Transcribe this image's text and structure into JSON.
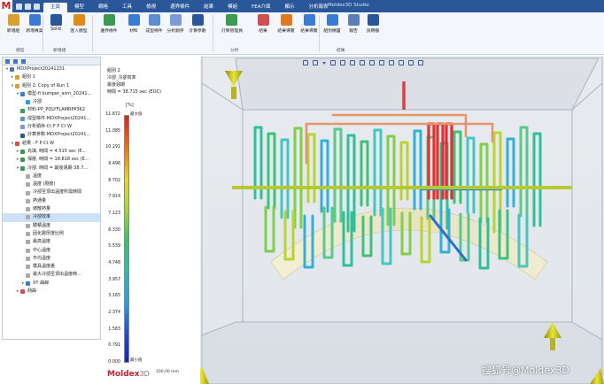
{
  "titlebar": {
    "logo": "M",
    "window_title": "Moldex3D Studio",
    "tabs": [
      "主頁",
      "模型",
      "網格",
      "工具",
      "檢視",
      "邊界條件",
      "結果",
      "模組",
      "FEA介面",
      "顯示",
      "分析報表"
    ],
    "active_tab": 0
  },
  "ribbon": {
    "buttons": [
      {
        "label": "新增組",
        "icon": "new-group-icon",
        "color": "#d9a030"
      },
      {
        "label": "新增專案",
        "icon": "new-project-icon",
        "color": "#3a7bd5"
      },
      {
        "label": "Solid",
        "icon": "solid-icon",
        "color": "#2a579a"
      },
      {
        "label": "匯入模型",
        "icon": "import-model-icon",
        "color": "#e08a1a"
      },
      {
        "label": "邊界條件",
        "icon": "boundary-icon",
        "color": "#3c9a50"
      },
      {
        "label": "材料",
        "icon": "material-icon",
        "color": "#3a7bd5"
      },
      {
        "label": "成型條件",
        "icon": "process-condition-icon",
        "color": "#5a8fd0"
      },
      {
        "label": "分析順序",
        "icon": "analysis-sequence-icon",
        "color": "#7a9ad8"
      },
      {
        "label": "計算參數",
        "icon": "compute-param-icon",
        "color": "#2a579a"
      },
      {
        "label": "計算管理員",
        "icon": "job-manager-icon",
        "color": "#3c9a50"
      },
      {
        "label": "結果",
        "icon": "result-icon",
        "color": "#d05050"
      },
      {
        "label": "結果導覽",
        "icon": "result-nav-icon",
        "color": "#e07a20"
      },
      {
        "label": "結果導覽",
        "icon": "result-guide-icon",
        "color": "#3a7bd5"
      },
      {
        "label": "組別精靈",
        "icon": "group-wizard-icon",
        "color": "#3a7bd5"
      },
      {
        "label": "報告",
        "icon": "report-icon",
        "color": "#5a7fb8"
      },
      {
        "label": "說明檔",
        "icon": "help-doc-icon",
        "color": "#2a579a"
      }
    ],
    "groups": [
      "模型",
      "新增組",
      "分析",
      "結果"
    ]
  },
  "tree": {
    "rows": [
      {
        "label": "MDXProject20241231",
        "level": 0,
        "toggle": "▾",
        "icon_color": "#4a73b3"
      },
      {
        "label": "組別 1",
        "level": 1,
        "toggle": "▸",
        "icon_color": "#d9a030"
      },
      {
        "label": "組別 2: Copy of Run 1",
        "level": 1,
        "toggle": "▾",
        "icon_color": "#d9a030"
      },
      {
        "label": "模型-fi bumper_asm_20241...",
        "level": 2,
        "toggle": "▾",
        "icon_color": "#3a7bd5"
      },
      {
        "label": "冷卻",
        "level": 3,
        "toggle": "",
        "icon_color": "#2a9ee0"
      },
      {
        "label": "材料-PP_POLYFLAMRPP362",
        "level": 2,
        "toggle": "",
        "icon_color": "#3c9a50"
      },
      {
        "label": "成型條件-MDXProject20241...",
        "level": 2,
        "toggle": "",
        "icon_color": "#5a8fd0"
      },
      {
        "label": "分析順序-Ct F P Ct W",
        "level": 2,
        "toggle": "",
        "icon_color": "#7a9ad8"
      },
      {
        "label": "計算參數-MDXProject20241...",
        "level": 2,
        "toggle": "",
        "icon_color": "#2a579a"
      },
      {
        "label": "結果 - F P Ct W",
        "level": 1,
        "toggle": "▾",
        "icon_color": "#d05050"
      },
      {
        "label": "充填, 時間 = 4.515 sec (E...",
        "level": 2,
        "toggle": "▸",
        "icon_color": "#3c9a50"
      },
      {
        "label": "保壓, 時間 = 18.818 sec (E...",
        "level": 2,
        "toggle": "▸",
        "icon_color": "#3c9a50"
      },
      {
        "label": "冷卻, 時間 = 最後週期 38.7...",
        "level": 2,
        "toggle": "▾",
        "icon_color": "#3c9a50"
      },
      {
        "label": "溫度",
        "level": 3,
        "toggle": "",
        "icon_color": "#aaaaaa"
      },
      {
        "label": "溫度 (剛度)",
        "level": 3,
        "toggle": "",
        "icon_color": "#aaaaaa"
      },
      {
        "label": "冷卻至頂出溫度所需時間",
        "level": 3,
        "toggle": "",
        "icon_color": "#aaaaaa"
      },
      {
        "label": "熱通量",
        "level": 3,
        "toggle": "",
        "icon_color": "#aaaaaa"
      },
      {
        "label": "總散熱量",
        "level": 3,
        "toggle": "",
        "icon_color": "#aaaaaa"
      },
      {
        "label": "冷卻效率",
        "level": 3,
        "toggle": "",
        "icon_color": "#aaaaaa",
        "selected": true
      },
      {
        "label": "體積溫度",
        "level": 3,
        "toggle": "",
        "icon_color": "#aaaaaa"
      },
      {
        "label": "固化層厚度比例",
        "level": 3,
        "toggle": "",
        "icon_color": "#aaaaaa"
      },
      {
        "label": "最高溫度",
        "level": 3,
        "toggle": "",
        "icon_color": "#aaaaaa"
      },
      {
        "label": "中心溫度",
        "level": 3,
        "toggle": "",
        "icon_color": "#aaaaaa"
      },
      {
        "label": "平均溫度",
        "level": 3,
        "toggle": "",
        "icon_color": "#aaaaaa"
      },
      {
        "label": "模具溫度差",
        "level": 3,
        "toggle": "",
        "icon_color": "#aaaaaa"
      },
      {
        "label": "最大冷卻至頂出溫度時...",
        "level": 3,
        "toggle": "",
        "icon_color": "#aaaaaa"
      },
      {
        "label": "XY 曲線",
        "level": 3,
        "toggle": "▸",
        "icon_color": "#3a7bd5"
      },
      {
        "label": "翹曲",
        "level": 2,
        "toggle": "▸",
        "icon_color": "#d05050"
      }
    ]
  },
  "legend": {
    "header_lines": [
      "組別 2",
      "冷卻_冷卻效率",
      "最後週期",
      "時間 = 38.715 sec (EOC)"
    ],
    "unit": "[%]",
    "ticks": [
      "11.872",
      "11.085",
      "10.291",
      "9.496",
      "8.702",
      "7.914",
      "7.123",
      "6.330",
      "5.539",
      "4.748",
      "3.957",
      "3.165",
      "2.374",
      "1.583",
      "0.791",
      "0.000"
    ],
    "max_label": "最大值",
    "min_label": "最小值"
  },
  "footer": {
    "logo_main": "Moldex",
    "logo_suffix": "3D",
    "scale": "100.00 mm"
  },
  "watermark": "搜狐号@Moldex3D",
  "colors": {
    "accent": "#2a579a",
    "brand_red": "#c8202a",
    "hot": "#e02020",
    "cold": "#1820b8"
  }
}
